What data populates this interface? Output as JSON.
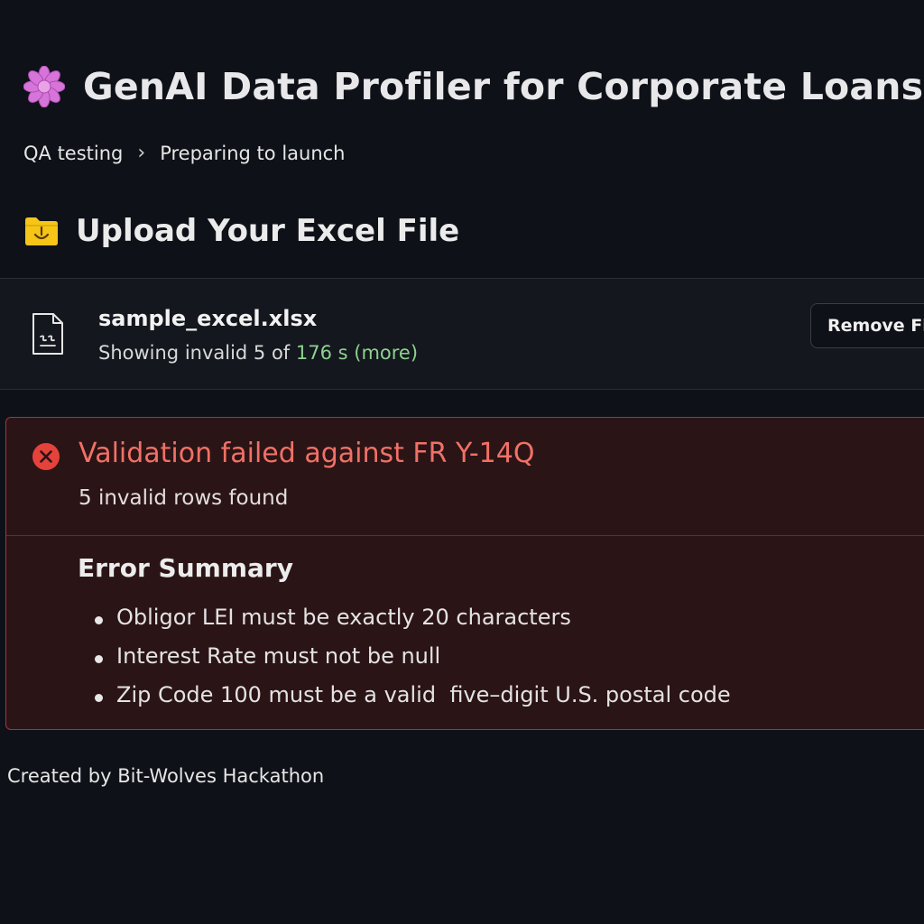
{
  "header": {
    "title": "GenAI Data Profiler for Corporate Loans",
    "icon": "flower-icon"
  },
  "breadcrumb": {
    "items": [
      "QA testing",
      "Preparing to launch"
    ],
    "separator": "›"
  },
  "upload": {
    "heading": "Upload Your Excel File",
    "icon": "folder-icon"
  },
  "file": {
    "name": "sample_excel.xlsx",
    "status_prefix": "Showing invalid 5 of ",
    "status_link": "176 s (more)",
    "remove_label": "Remove File",
    "icon": "file-icon"
  },
  "validation": {
    "title": "Validation failed against FR Y-14Q",
    "subtitle": "5 invalid rows found",
    "icon": "error-circle-x-icon",
    "summary_title": "Error Summary",
    "errors": [
      "Obligor LEI must be exactly 20 characters",
      "Interest Rate must not be null",
      "Zip Code 100 must be a valid  five–digit U.S. postal code"
    ]
  },
  "footer": {
    "text": "Created by Bit-Wolves Hackathon"
  },
  "colors": {
    "background": "#0e1117",
    "error_text": "#f07166",
    "error_bg": "#2b1416",
    "error_border": "#a3353a",
    "link_green": "#8ed18f",
    "folder_yellow": "#f5c518",
    "flower_pink": "#d774d9"
  }
}
